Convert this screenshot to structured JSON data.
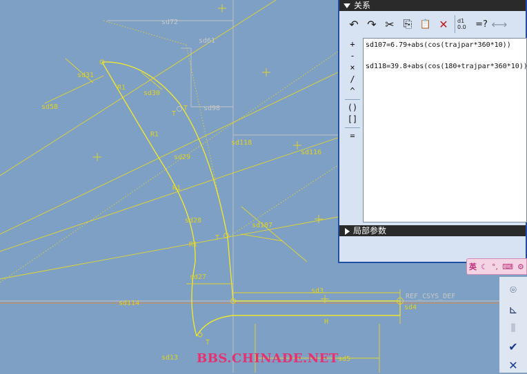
{
  "relations_panel": {
    "title": "关系",
    "toolbar": {
      "undo_glyph": "↶",
      "redo_glyph": "↷",
      "cut_glyph": "✂",
      "copy_glyph": "⎘",
      "paste_glyph": "📋",
      "delete_glyph": "✕",
      "value_glyph": "d1 0.0",
      "evaluate_glyph": "=?",
      "measure_glyph": "⟷"
    },
    "operators": [
      "+",
      "-",
      "×",
      "/",
      "^",
      "()",
      "[]",
      "="
    ],
    "relations": [
      "sd107=6.79+abs(cos(trajpar*360*10))",
      "sd118=39.8+abs(cos(180+trajpar*360*10))"
    ],
    "local_params_title": "局部参数"
  },
  "sketch": {
    "dimension_labels": {
      "sd72": "sd72",
      "sd61": "sd61",
      "sd31": "sd31",
      "sd58": "sd58",
      "sd30": "sd30",
      "sd98": "sd98",
      "sd118": "sd118",
      "sd116": "sd116",
      "sd29": "sd29",
      "sd28": "sd28",
      "sd107": "sd107",
      "sd27": "sd27",
      "sd114": "sd114",
      "sd3": "sd3",
      "sd4": "sd4",
      "sd13": "sd13",
      "sd5": "sd5",
      "ref": "REF_CSYS_DEF",
      "H": "H",
      "T": "T",
      "R1": "R1"
    }
  },
  "ime_bar": {
    "label": "英"
  },
  "right_tools": {
    "confirm_glyph": "✔",
    "cancel_glyph": "✕"
  },
  "watermark": "BBS.CHINADE.NET",
  "colors": {
    "background": "#7ea0c4",
    "sketch": "#f0e632",
    "panel_border": "#1f4fa3"
  }
}
